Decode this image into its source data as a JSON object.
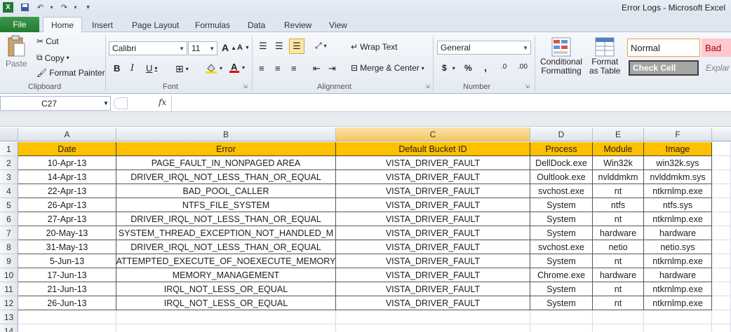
{
  "window": {
    "title": "Error Logs  -  Microsoft Excel"
  },
  "ribbon_tabs": [
    "File",
    "Home",
    "Insert",
    "Page Layout",
    "Formulas",
    "Data",
    "Review",
    "View"
  ],
  "clipboard": {
    "paste": "Paste",
    "cut": "Cut",
    "copy": "Copy",
    "format_painter": "Format Painter",
    "label": "Clipboard"
  },
  "font": {
    "name": "Calibri",
    "size": "11",
    "bold": "B",
    "italic": "I",
    "underline": "U",
    "grow": "A",
    "shrink": "A",
    "label": "Font"
  },
  "alignment": {
    "wrap_text": "Wrap Text",
    "merge_center": "Merge & Center",
    "label": "Alignment"
  },
  "number": {
    "format": "General",
    "currency": "$",
    "percent": "%",
    "comma": ",",
    "inc_decimal": ".00",
    "dec_decimal": ".0",
    "label": "Number"
  },
  "styles": {
    "conditional_formatting_1": "Conditional",
    "conditional_formatting_2": "Formatting",
    "format_table_1": "Format",
    "format_table_2": "as Table",
    "normal": "Normal",
    "bad": "Bad",
    "check_cell": "Check Cell",
    "explanatory": "Explar"
  },
  "formula_bar": {
    "name_box": "C27",
    "fx": "fx",
    "content": ""
  },
  "columns": [
    "A",
    "B",
    "C",
    "D",
    "E",
    "F"
  ],
  "rows": [
    "1",
    "2",
    "3",
    "4",
    "5",
    "6",
    "7",
    "8",
    "9",
    "10",
    "11",
    "12",
    "13",
    "14"
  ],
  "table": {
    "headers": [
      "Date",
      "Error",
      "Default Bucket ID",
      "Process",
      "Module",
      "Image"
    ],
    "data": [
      [
        "10-Apr-13",
        "PAGE_FAULT_IN_NONPAGED AREA",
        "VISTA_DRIVER_FAULT",
        "DellDock.exe",
        "Win32k",
        "win32k.sys"
      ],
      [
        "14-Apr-13",
        "DRIVER_IRQL_NOT_LESS_THAN_OR_EQUAL",
        "VISTA_DRIVER_FAULT",
        "Oultlook.exe",
        "nvlddmkm",
        "nvlddmkm.sys"
      ],
      [
        "22-Apr-13",
        "BAD_POOL_CALLER",
        "VISTA_DRIVER_FAULT",
        "svchost.exe",
        "nt",
        "ntkrnlmp.exe"
      ],
      [
        "26-Apr-13",
        "NTFS_FILE_SYSTEM",
        "VISTA_DRIVER_FAULT",
        "System",
        "ntfs",
        "ntfs.sys"
      ],
      [
        "27-Apr-13",
        "DRIVER_IRQL_NOT_LESS_THAN_OR_EQUAL",
        "VISTA_DRIVER_FAULT",
        "System",
        "nt",
        "ntkrnlmp.exe"
      ],
      [
        "20-May-13",
        "SYSTEM_THREAD_EXCEPTION_NOT_HANDLED_M",
        "VISTA_DRIVER_FAULT",
        "System",
        "hardware",
        "hardware"
      ],
      [
        "31-May-13",
        "DRIVER_IRQL_NOT_LESS_THAN_OR_EQUAL",
        "VISTA_DRIVER_FAULT",
        "svchost.exe",
        "netio",
        "netio.sys"
      ],
      [
        "5-Jun-13",
        "ATTEMPTED_EXECUTE_OF_NOEXECUTE_MEMORY",
        "VISTA_DRIVER_FAULT",
        "System",
        "nt",
        "ntkrnlmp.exe"
      ],
      [
        "17-Jun-13",
        "MEMORY_MANAGEMENT",
        "VISTA_DRIVER_FAULT",
        "Chrome.exe",
        "hardware",
        "hardware"
      ],
      [
        "21-Jun-13",
        "IRQL_NOT_LESS_OR_EQUAL",
        "VISTA_DRIVER_FAULT",
        "System",
        "nt",
        "ntkrnlmp.exe"
      ],
      [
        "26-Jun-13",
        "IRQL_NOT_LESS_OR_EQUAL",
        "VISTA_DRIVER_FAULT",
        "System",
        "nt",
        "ntkrnlmp.exe"
      ]
    ]
  },
  "colors": {
    "header_fill": "#ffc000",
    "file_tab": "#2e8b3d",
    "selected_col": "#f5c661"
  }
}
